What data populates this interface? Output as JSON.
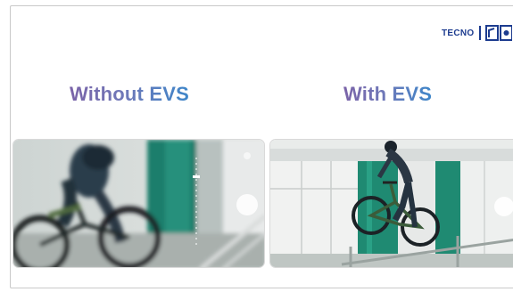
{
  "brand": {
    "name": "TECNO",
    "logo_icon": "tecno-camera-logo-icon",
    "color": "#1d3c8f"
  },
  "comparison": {
    "left_label": "Without EVS",
    "right_label": "With EVS",
    "label_gradient": [
      "#7a63a8",
      "#3e86c9"
    ]
  },
  "photos": {
    "left_icon": "blurry-cyclist-photo",
    "right_icon": "stabilized-cyclist-photo"
  }
}
